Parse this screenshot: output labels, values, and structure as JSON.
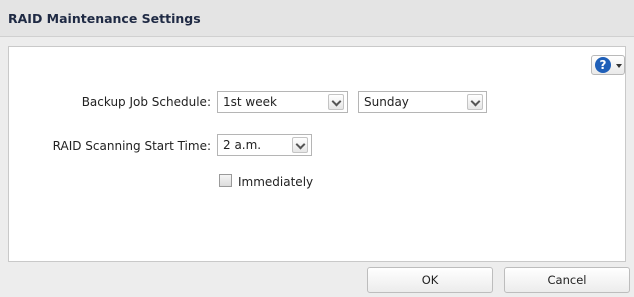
{
  "dialog": {
    "title": "RAID Maintenance Settings"
  },
  "help": {
    "icon": "help-icon",
    "glyph": "?"
  },
  "form": {
    "backup_schedule": {
      "label": "Backup Job Schedule:",
      "week_value": "1st week",
      "day_value": "Sunday"
    },
    "scan_start": {
      "label": "RAID Scanning Start Time:",
      "time_value": "2 a.m."
    },
    "immediately": {
      "label": "Immediately",
      "checked": false
    }
  },
  "buttons": {
    "ok": "OK",
    "cancel": "Cancel"
  },
  "colors": {
    "help_accent": "#1f5fb8"
  }
}
